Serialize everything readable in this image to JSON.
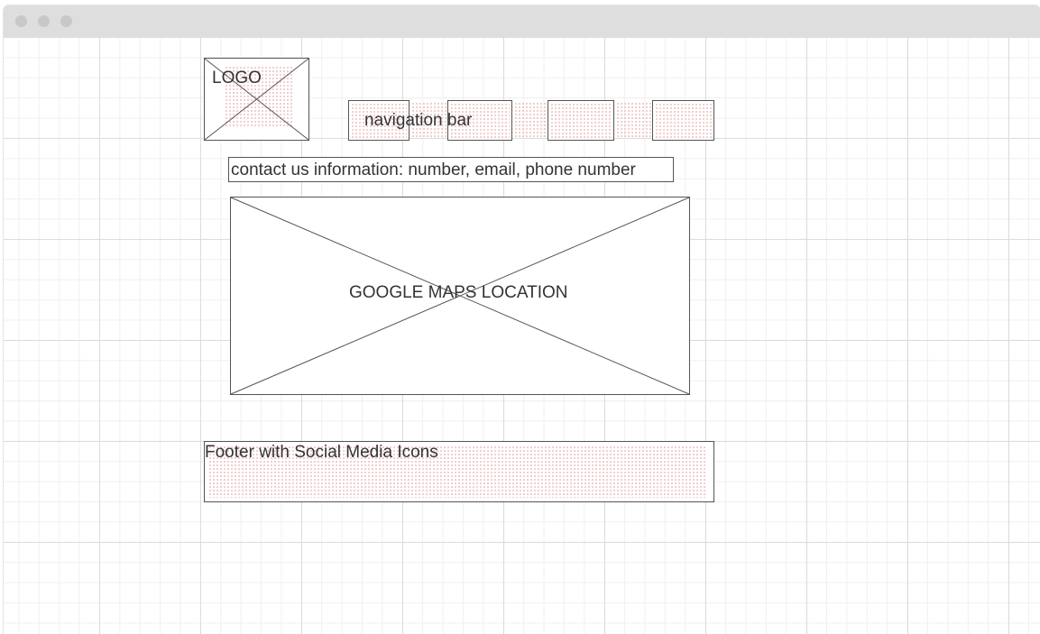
{
  "wireframe": {
    "logo": {
      "label": "LOGO",
      "icon": "image-placeholder-icon"
    },
    "navigation": {
      "label": "navigation bar",
      "item_count": 4
    },
    "contact": {
      "label": "contact us information: number, email, phone number"
    },
    "map": {
      "label": "GOOGLE MAPS LOCATION",
      "icon": "image-placeholder-icon"
    },
    "footer": {
      "label": "Footer with Social Media Icons"
    }
  },
  "colors": {
    "stroke": "#555555",
    "titlebar": "#dedede",
    "dot_fill": "#e7a3a3",
    "grid": "#dcdcdc"
  }
}
